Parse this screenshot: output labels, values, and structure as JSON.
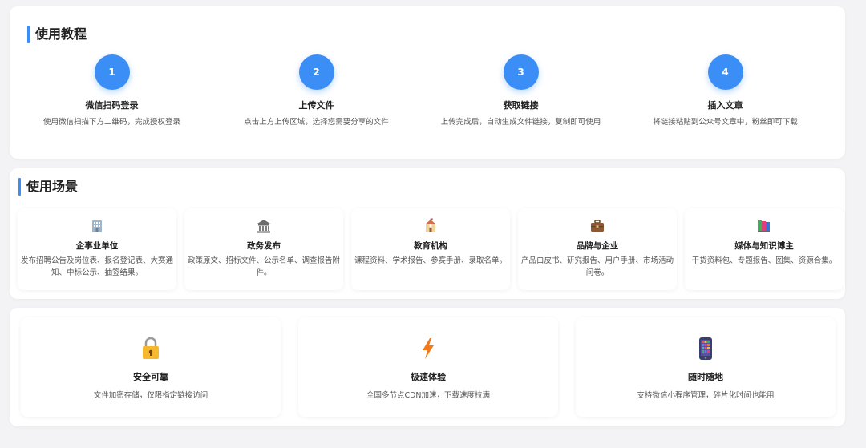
{
  "tutorial": {
    "title": "使用教程",
    "steps": [
      {
        "number": "1",
        "name": "微信扫码登录",
        "desc": "使用微信扫描下方二维码，完成授权登录"
      },
      {
        "number": "2",
        "name": "上传文件",
        "desc": "点击上方上传区域，选择您需要分享的文件"
      },
      {
        "number": "3",
        "name": "获取链接",
        "desc": "上传完成后，自动生成文件链接，复制即可使用"
      },
      {
        "number": "4",
        "name": "插入文章",
        "desc": "将链接粘贴到公众号文章中，粉丝即可下载"
      }
    ]
  },
  "scenes": {
    "title": "使用场景",
    "items": [
      {
        "icon": "office-building-icon",
        "name": "企事业单位",
        "desc": "发布招聘公告及岗位表、报名登记表、大赛通知、中标公示、抽签结果。"
      },
      {
        "icon": "government-building-icon",
        "name": "政务发布",
        "desc": "政策原文、招标文件、公示名单、调查报告附件。"
      },
      {
        "icon": "school-icon",
        "name": "教育机构",
        "desc": "课程资料、学术报告、参赛手册、录取名单。"
      },
      {
        "icon": "briefcase-icon",
        "name": "品牌与企业",
        "desc": "产品白皮书、研究报告、用户手册、市场活动问卷。"
      },
      {
        "icon": "books-icon",
        "name": "媒体与知识博主",
        "desc": "干货资料包、专题报告、图集、资源合集。"
      }
    ]
  },
  "features": {
    "items": [
      {
        "icon": "lock-icon",
        "name": "安全可靠",
        "desc": "文件加密存储，仅限指定链接访问"
      },
      {
        "icon": "lightning-icon",
        "name": "极速体验",
        "desc": "全国多节点CDN加速，下载速度拉满"
      },
      {
        "icon": "mobile-phone-icon",
        "name": "随时随地",
        "desc": "支持微信小程序管理，碎片化时间也能用"
      }
    ]
  },
  "colors": {
    "accent": "#3a8ef6",
    "background": "#f3f3f5",
    "card": "#ffffff"
  }
}
